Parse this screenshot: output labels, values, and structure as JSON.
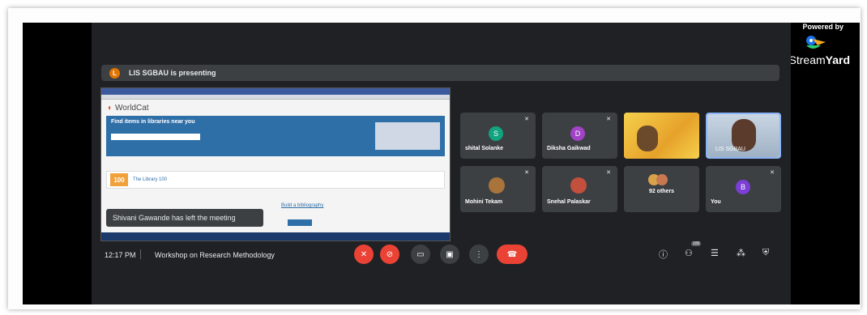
{
  "presentation": {
    "presenter_initial": "L",
    "banner_text": "LIS SGBAU is presenting"
  },
  "shared_screen": {
    "site_name": "WorldCat",
    "banner_title": "Find items in libraries near you",
    "library_badge": "100",
    "library_title": "The Library 100",
    "bibliography_link": "Build a bibliography"
  },
  "toast": "Shivani Gawande has left the meeting",
  "participants": [
    {
      "name": "shital Solanke",
      "initial": "S",
      "color": "#12a37f"
    },
    {
      "name": "Diksha Gaikwad",
      "initial": "D",
      "color": "#a142c7"
    },
    {
      "name": "Mohini Tekam"
    },
    {
      "name": "Snehal Palaskar"
    },
    {
      "name": "92 others"
    },
    {
      "name": "You",
      "initial": "B",
      "color": "#7b3ed6"
    },
    {
      "name": "LIS SGBAU"
    }
  ],
  "meeting": {
    "time": "12:17 PM",
    "title": "Workshop on Research Methodology",
    "participant_count": "100"
  },
  "streamyard": {
    "powered_by": "Powered by",
    "brand_light": "Stream",
    "brand_bold": "Yard"
  },
  "colors": {
    "meet_bg": "#202124",
    "tile_bg": "#3c4043",
    "red_button": "#ea4335",
    "presenter_badge": "#e37400"
  },
  "icons": {
    "mic": "mic-off-icon",
    "camera": "camera-off-icon",
    "captions": "captions-icon",
    "present": "present-icon",
    "more": "more-options-icon",
    "hangup": "hangup-icon",
    "info": "info-icon",
    "people": "people-icon",
    "chat": "chat-icon",
    "activities": "activities-icon",
    "host": "host-controls-icon"
  }
}
